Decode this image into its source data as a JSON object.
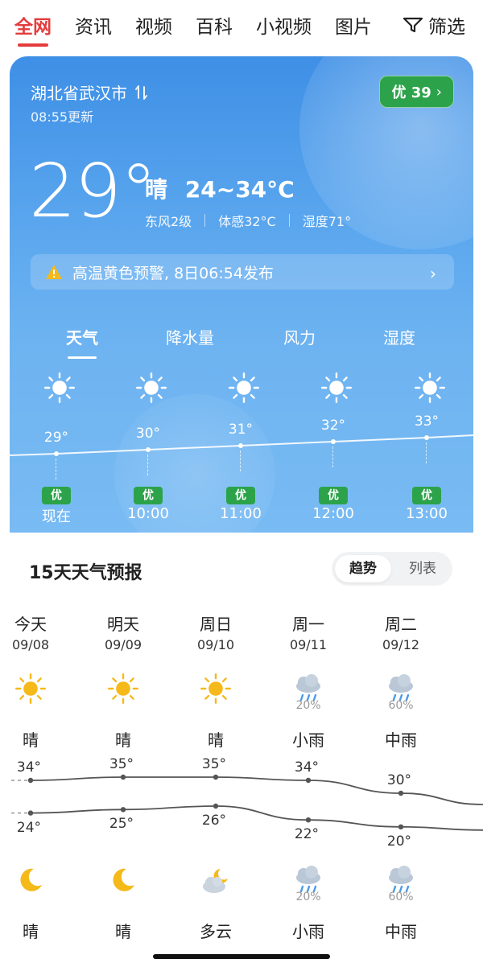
{
  "nav": {
    "tabs": [
      "全网",
      "资讯",
      "视频",
      "百科",
      "小视频",
      "图片"
    ],
    "active": 0,
    "filter_label": "筛选"
  },
  "weather": {
    "location": "湖北省武汉市",
    "location_icon": "location-arrows-icon",
    "updated": "08:55更新",
    "aqi_label": "优 39",
    "temp": "29°",
    "condition": "晴",
    "range": "24~34°C",
    "wind": "东风2级",
    "feels": "体感32°C",
    "humidity": "湿度71°",
    "alert": "高温黄色预警, 8日06:54发布"
  },
  "weather_tabs": [
    "天气",
    "降水量",
    "风力",
    "湿度"
  ],
  "hourly": [
    {
      "temp": "29°",
      "temp_value": 29,
      "aqi": "优",
      "time": "现在",
      "icon": "sun-icon"
    },
    {
      "temp": "30°",
      "temp_value": 30,
      "aqi": "优",
      "time": "10:00",
      "icon": "sun-icon"
    },
    {
      "temp": "31°",
      "temp_value": 31,
      "aqi": "优",
      "time": "11:00",
      "icon": "sun-icon"
    },
    {
      "temp": "32°",
      "temp_value": 32,
      "aqi": "优",
      "time": "12:00",
      "icon": "sun-icon"
    },
    {
      "temp": "33°",
      "temp_value": 33,
      "aqi": "优",
      "time": "13:00",
      "icon": "sun-icon"
    }
  ],
  "forecast": {
    "title": "15天天气预报",
    "view_options": [
      "趋势",
      "列表"
    ],
    "active_view": 0,
    "days": [
      {
        "name": "今天",
        "date": "09/08",
        "day_icon": "sun-icon",
        "day_pct": "",
        "day_cond": "晴",
        "high": "34°",
        "high_value": 34,
        "low": "24°",
        "low_value": 24,
        "night_icon": "moon-icon",
        "night_pct": "",
        "night_cond": "晴"
      },
      {
        "name": "明天",
        "date": "09/09",
        "day_icon": "sun-icon",
        "day_pct": "",
        "day_cond": "晴",
        "high": "35°",
        "high_value": 35,
        "low": "25°",
        "low_value": 25,
        "night_icon": "moon-icon",
        "night_pct": "",
        "night_cond": "晴"
      },
      {
        "name": "周日",
        "date": "09/10",
        "day_icon": "sun-icon",
        "day_pct": "",
        "day_cond": "晴",
        "high": "35°",
        "high_value": 35,
        "low": "26°",
        "low_value": 26,
        "night_icon": "moon-cloud-icon",
        "night_pct": "",
        "night_cond": "多云"
      },
      {
        "name": "周一",
        "date": "09/11",
        "day_icon": "rain-cloud-icon",
        "day_pct": "20%",
        "day_cond": "小雨",
        "high": "34°",
        "high_value": 34,
        "low": "22°",
        "low_value": 22,
        "night_icon": "rain-cloud-icon",
        "night_pct": "20%",
        "night_cond": "小雨"
      },
      {
        "name": "周二",
        "date": "09/12",
        "day_icon": "rain-cloud-icon",
        "day_pct": "60%",
        "day_cond": "中雨",
        "high": "30°",
        "high_value": 30,
        "low": "20°",
        "low_value": 20,
        "night_icon": "rain-cloud-icon",
        "night_pct": "60%",
        "night_cond": "中雨"
      }
    ]
  },
  "colors": {
    "accent": "#e43c3c",
    "aqi_good": "#2ca34a",
    "sun": "#f5b91a"
  }
}
